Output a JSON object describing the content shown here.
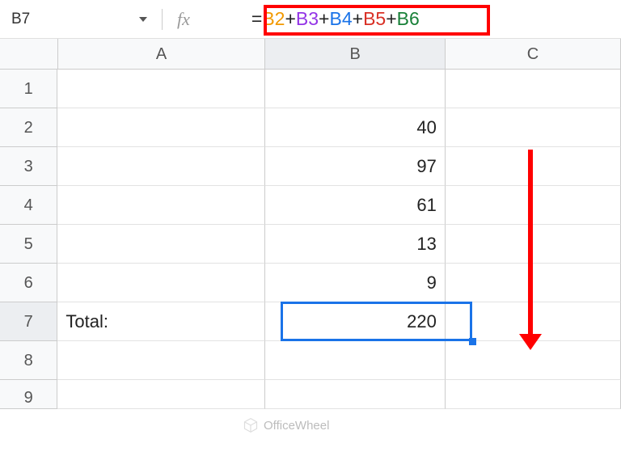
{
  "nameBox": {
    "value": "B7"
  },
  "fxLabel": "fx",
  "formula": {
    "eq": "=",
    "r1": "B2",
    "r2": "B3",
    "r3": "B4",
    "r4": "B5",
    "r5": "B6",
    "plus": "+"
  },
  "columns": {
    "A": "A",
    "B": "B",
    "C": "C"
  },
  "rows": {
    "1": "1",
    "2": "2",
    "3": "3",
    "4": "4",
    "5": "5",
    "6": "6",
    "7": "7",
    "8": "8",
    "9": "9"
  },
  "cells": {
    "A7": "Total:",
    "B2": "40",
    "B3": "97",
    "B4": "61",
    "B5": "13",
    "B6": "9",
    "B7": "220"
  },
  "watermark": "OfficeWheel"
}
